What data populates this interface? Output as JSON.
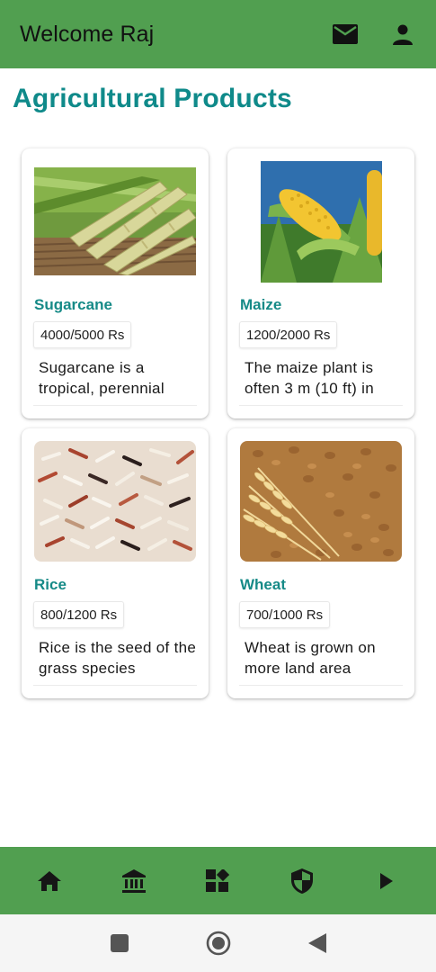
{
  "app_bar": {
    "title": "Welcome Raj",
    "icons": [
      "mail-icon",
      "account-icon"
    ],
    "color": "#519f50"
  },
  "page": {
    "title": "Agricultural Products",
    "title_color": "#0f8a8a"
  },
  "products": [
    {
      "name": "Sugarcane",
      "price": "4000/5000 Rs",
      "description": "Sugarcane is a tropical, perennial",
      "image": "sugarcane-image"
    },
    {
      "name": "Maize",
      "price": "1200/2000 Rs",
      "description": "The maize plant is often 3 m (10 ft) in",
      "image": "maize-image"
    },
    {
      "name": "Rice",
      "price": "800/1200 Rs",
      "description": "Rice is the seed of the grass species",
      "image": "rice-image"
    },
    {
      "name": "Wheat",
      "price": "700/1000 Rs",
      "description": "Wheat is grown on more land area",
      "image": "wheat-image"
    }
  ],
  "bottom_nav": {
    "items": [
      "home-icon",
      "bank-icon",
      "dashboard-icon",
      "shield-icon",
      "play-arrow-icon"
    ]
  },
  "system_nav": {
    "items": [
      "recents-square-icon",
      "home-circle-icon",
      "back-triangle-icon"
    ]
  }
}
